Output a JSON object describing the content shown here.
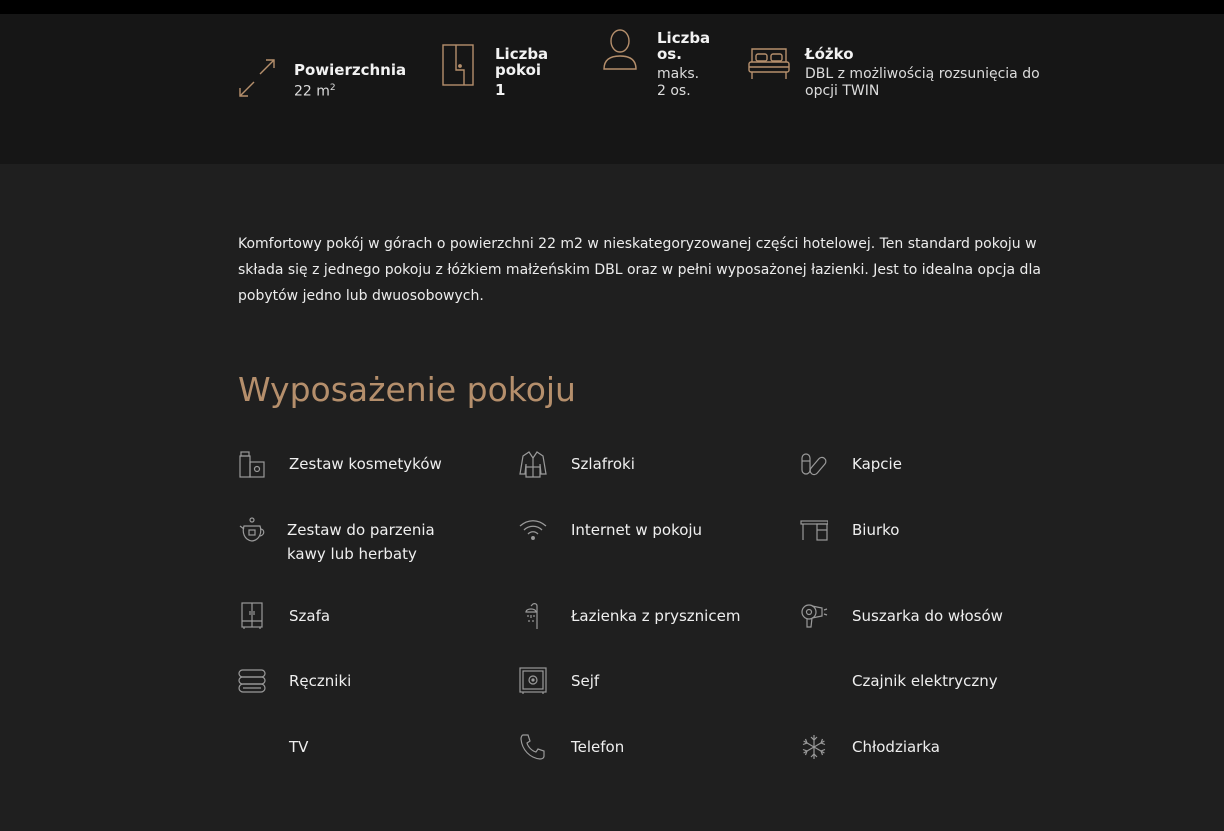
{
  "specs": {
    "area": {
      "label": "Powierzchnia",
      "value": "22 m",
      "sup": "2",
      "icon": "resize-diagonal-icon"
    },
    "rooms": {
      "label": "Liczba pokoi",
      "value": "1",
      "icon": "door-icon"
    },
    "guests": {
      "label": "Liczba os.",
      "value": "maks. 2 os.",
      "icon": "person-icon"
    },
    "bed": {
      "label": "Łóżko",
      "value": "DBL z możliwością rozsunięcia do opcji TWIN",
      "icon": "bed-icon"
    }
  },
  "description": "Komfortowy pokój w górach o powierzchni 22 m2 w nieskategoryzowanej części hotelowej. Ten standard pokoju w składa się z jednego pokoju z łóżkiem małżeńskim DBL oraz w pełni wyposażonej łazienki. Jest to idealna opcja dla pobytów jedno lub dwuosobowych.",
  "amenities": {
    "title": "Wyposażenie pokoju",
    "items": [
      {
        "label": "Zestaw kosmetyków",
        "icon": "cosmetics-icon"
      },
      {
        "label": "Szlafroki",
        "icon": "bathrobe-icon"
      },
      {
        "label": "Kapcie",
        "icon": "slippers-icon"
      },
      {
        "label": "Zestaw do parzenia kawy lub herbaty",
        "icon": "teapot-icon"
      },
      {
        "label": "Internet w pokoju",
        "icon": "wifi-icon"
      },
      {
        "label": "Biurko",
        "icon": "desk-icon"
      },
      {
        "label": "Szafa",
        "icon": "wardrobe-icon"
      },
      {
        "label": "Łazienka z prysznicem",
        "icon": "shower-icon"
      },
      {
        "label": "Suszarka do włosów",
        "icon": "hair-dryer-icon"
      },
      {
        "label": "Ręczniki",
        "icon": "towels-icon"
      },
      {
        "label": "Sejf",
        "icon": "safe-icon"
      },
      {
        "label": "Czajnik elektryczny",
        "icon": ""
      },
      {
        "label": "TV",
        "icon": ""
      },
      {
        "label": "Telefon",
        "icon": "phone-icon"
      },
      {
        "label": "Chłodziarka",
        "icon": "snowflake-icon"
      }
    ]
  },
  "colors": {
    "accent": "#b58f6c",
    "icon_gray": "#9a9a9a",
    "background": "#1e1e1e"
  }
}
